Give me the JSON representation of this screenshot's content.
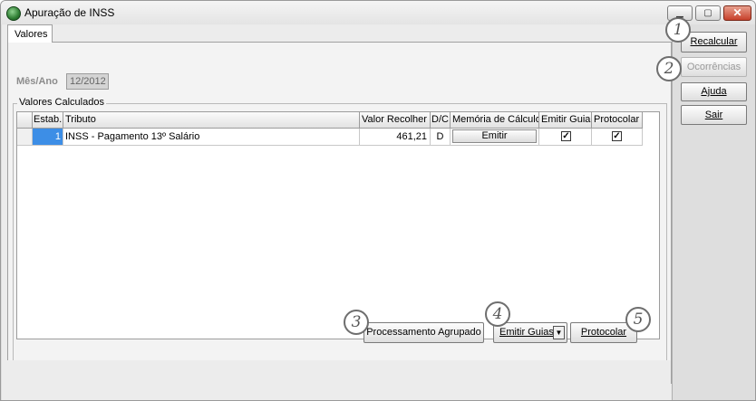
{
  "window": {
    "title": "Apuração de INSS"
  },
  "tabs": [
    {
      "label": "Valores"
    }
  ],
  "form": {
    "mes_ano_label": "Mês/Ano",
    "mes_ano_value": "12/2012"
  },
  "group": {
    "label": "Valores Calculados"
  },
  "table": {
    "columns": [
      "Estab.",
      "Tributo",
      "Valor Recolher",
      "D/C",
      "Memória de Cálculo",
      "Emitir Guia",
      "Protocolar"
    ],
    "rows": [
      {
        "estab": "1",
        "tributo": "INSS - Pagamento 13º Salário",
        "valor": "461,21",
        "dc": "D",
        "memoria_button": "Emitir",
        "emitir_guia": true,
        "protocolar": true
      }
    ]
  },
  "bottom_buttons": {
    "processamento": "Processamento Agrupado",
    "emitir_guias": "Emitir Guias",
    "protocolar": "Protocolar"
  },
  "side_buttons": {
    "recalcular": "Recalcular",
    "ocorrencias": "Ocorrências",
    "ajuda": "Ajuda",
    "sair": "Sair"
  },
  "markers": [
    "1",
    "2",
    "3",
    "4",
    "5"
  ],
  "colors": {
    "selection": "#3d8ee6",
    "close_button": "#c7402a",
    "accent_icon": "#2e7d32"
  }
}
